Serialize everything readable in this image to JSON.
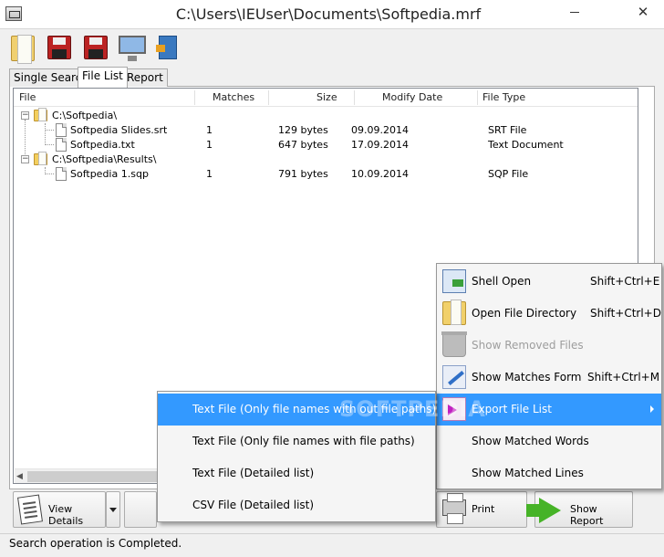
{
  "window": {
    "title": "C:\\Users\\IEUser\\Documents\\Softpedia.mrf",
    "close_glyph": "✕"
  },
  "toolbar": {
    "buttons": [
      {
        "name": "open",
        "icon": "open-folder-icon"
      },
      {
        "name": "save",
        "icon": "save-disk-icon"
      },
      {
        "name": "save-as",
        "icon": "save-disk-icon"
      },
      {
        "name": "monitor",
        "icon": "monitor-icon"
      },
      {
        "name": "exit",
        "icon": "exit-door-icon"
      }
    ]
  },
  "tabs": [
    {
      "label": "Single Search",
      "active": false
    },
    {
      "label": "File List",
      "active": true
    },
    {
      "label": "Report",
      "active": false
    }
  ],
  "file_list": {
    "columns": {
      "file": "File",
      "matches": "Matches",
      "size": "Size",
      "modify_date": "Modify Date",
      "file_type": "File Type"
    },
    "rows": [
      {
        "kind": "folder",
        "name": "C:\\Softpedia\\",
        "matches": "",
        "size": "",
        "date": "",
        "type": ""
      },
      {
        "kind": "file",
        "name": "Softpedia Slides.srt",
        "matches": "1",
        "size": "129 bytes",
        "date": "09.09.2014",
        "type": "SRT File"
      },
      {
        "kind": "file",
        "name": "Softpedia.txt",
        "matches": "1",
        "size": "647 bytes",
        "date": "17.09.2014",
        "type": "Text Document"
      },
      {
        "kind": "folder",
        "name": "C:\\Softpedia\\Results\\",
        "matches": "",
        "size": "",
        "date": "",
        "type": ""
      },
      {
        "kind": "file",
        "name": "Softpedia 1.sqp",
        "matches": "1",
        "size": "791 bytes",
        "date": "10.09.2014",
        "type": "SQP File"
      }
    ]
  },
  "bottom": {
    "view_details": "View Details",
    "print": "Print",
    "show_report": "Show Report"
  },
  "status": {
    "text": "Search operation is Completed."
  },
  "context_menu": {
    "items": [
      {
        "label": "Shell Open",
        "shortcut": "Shift+Ctrl+E",
        "icon": "shell-open-icon",
        "disabled": false,
        "highlighted": false
      },
      {
        "label": "Open File Directory",
        "shortcut": "Shift+Ctrl+D",
        "icon": "folder-icon",
        "disabled": false,
        "highlighted": false
      },
      {
        "label": "Show Removed Files",
        "shortcut": "",
        "icon": "recycle-bin-icon",
        "disabled": true,
        "highlighted": false
      },
      {
        "label": "Show Matches Form",
        "shortcut": "Shift+Ctrl+M",
        "icon": "matches-form-icon",
        "disabled": false,
        "highlighted": false
      },
      {
        "label": "Export File List",
        "shortcut": "",
        "icon": "export-icon",
        "disabled": false,
        "highlighted": true
      },
      {
        "label": "Show Matched Words",
        "shortcut": "",
        "icon": "",
        "disabled": false,
        "highlighted": false
      },
      {
        "label": "Show Matched Lines",
        "shortcut": "",
        "icon": "",
        "disabled": false,
        "highlighted": false
      }
    ]
  },
  "submenu": {
    "items": [
      {
        "label": "Text File (Only file names with out file paths)",
        "highlighted": true
      },
      {
        "label": "Text File (Only file names with file paths)",
        "highlighted": false
      },
      {
        "label": "Text File (Detailed list)",
        "highlighted": false
      },
      {
        "label": "CSV File (Detailed list)",
        "highlighted": false
      }
    ]
  },
  "watermark": "SOFTPEDIA",
  "colors": {
    "highlight": "#3399ff",
    "disabled_text": "#9d9d9d"
  }
}
